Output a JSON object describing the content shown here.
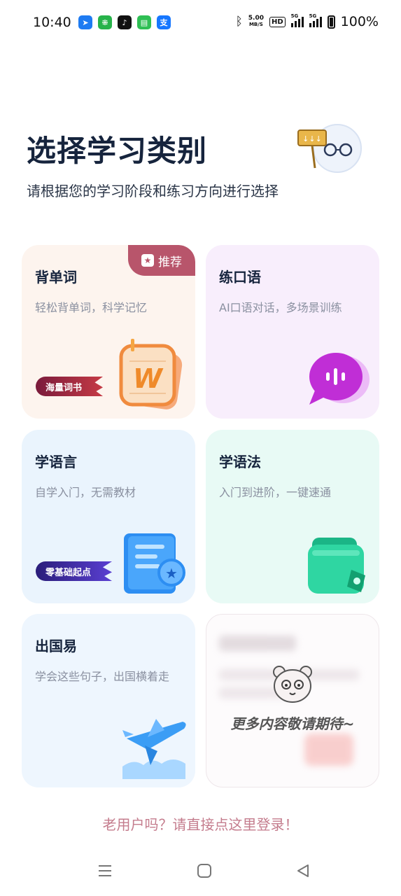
{
  "status_bar": {
    "time": "10:40",
    "net_speed_value": "5.00",
    "net_speed_unit": "MB/S",
    "hd": "HD",
    "signal1_tag": "5G",
    "signal2_tag": "5G",
    "battery": "100%",
    "app_icons": [
      "navigation-app-icon",
      "wechat-work-icon",
      "tiktok-icon",
      "messages-icon",
      "alipay-icon"
    ]
  },
  "header": {
    "title": "选择学习类别",
    "subtitle": "请根据您的学习阶段和练习方向进行选择"
  },
  "cards": [
    {
      "title": "背单词",
      "desc": "轻松背单词，科学记忆",
      "badge": "推荐",
      "ribbon": "海量词书",
      "icon_letter": "W"
    },
    {
      "title": "练口语",
      "desc": "AI口语对话，多场景训练"
    },
    {
      "title": "学语言",
      "desc": "自学入门，无需教材",
      "ribbon": "零基础起点"
    },
    {
      "title": "学语法",
      "desc": "入门到进阶，一键速通"
    },
    {
      "title": "出国易",
      "desc": "学会这些句子，出国横着走"
    },
    {
      "title": "更多内容敬请期待~"
    }
  ],
  "login_link": "老用户吗？请直接点这里登录！",
  "colors": {
    "title": "#16243d",
    "desc": "#8a90a0",
    "badge": "#b8556b",
    "login": "#c47c8d"
  }
}
